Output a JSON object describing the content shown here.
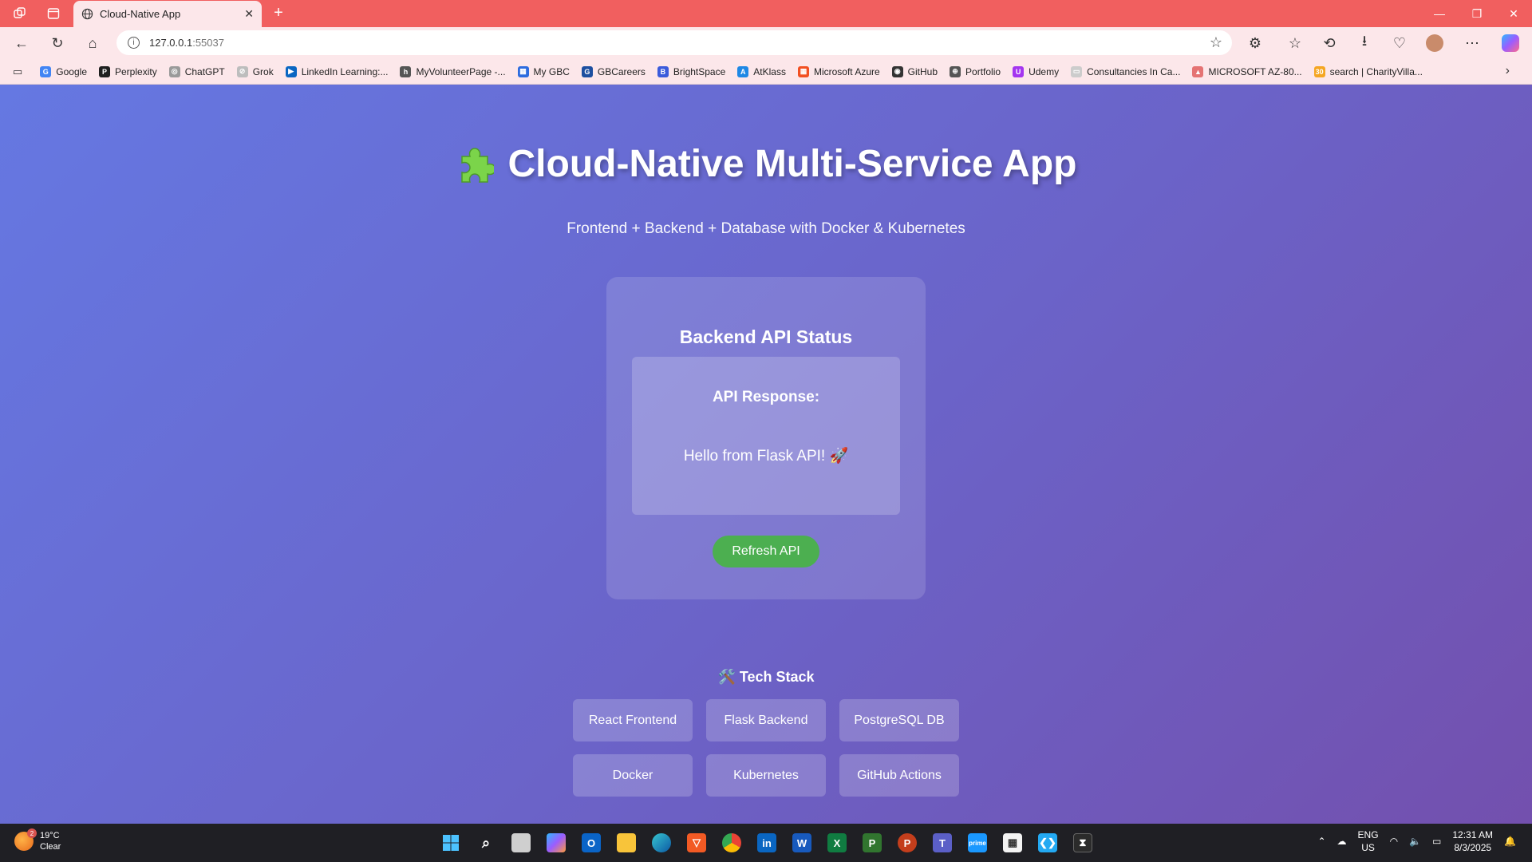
{
  "browser": {
    "tab_title": "Cloud-Native App",
    "url_host": "127.0.0.1",
    "url_port": ":55037",
    "bookmarks": [
      {
        "label": "Google",
        "color": "#4285f4",
        "glyph": "G"
      },
      {
        "label": "Perplexity",
        "color": "#1f1f1f",
        "glyph": "P"
      },
      {
        "label": "ChatGPT",
        "color": "#9a9a9a",
        "glyph": "◎"
      },
      {
        "label": "Grok",
        "color": "#bdbdbd",
        "glyph": "⊘"
      },
      {
        "label": "LinkedIn Learning:...",
        "color": "#0a66c2",
        "glyph": "▶"
      },
      {
        "label": "MyVolunteerPage -...",
        "color": "#555555",
        "glyph": "h"
      },
      {
        "label": "My GBC",
        "color": "#2d6cdf",
        "glyph": "▦"
      },
      {
        "label": "GBCareers",
        "color": "#1d4fa0",
        "glyph": "G"
      },
      {
        "label": "BrightSpace",
        "color": "#3b5bdb",
        "glyph": "B"
      },
      {
        "label": "AtKlass",
        "color": "#1e88e5",
        "glyph": "A"
      },
      {
        "label": "Microsoft Azure",
        "color": "#f25022",
        "glyph": "▦"
      },
      {
        "label": "GitHub",
        "color": "#333333",
        "glyph": "◉"
      },
      {
        "label": "Portfolio",
        "color": "#555555",
        "glyph": "⊕"
      },
      {
        "label": "Udemy",
        "color": "#a435f0",
        "glyph": "U"
      },
      {
        "label": "Consultancies In Ca...",
        "color": "#cccccc",
        "glyph": "▭"
      },
      {
        "label": "MICROSOFT AZ-80...",
        "color": "#e57373",
        "glyph": "▲"
      },
      {
        "label": "search | CharityVilla...",
        "color": "#f5a623",
        "glyph": "30"
      }
    ]
  },
  "page": {
    "title": "Cloud-Native Multi-Service App",
    "subtitle": "Frontend + Backend + Database with Docker & Kubernetes",
    "status_card": {
      "title": "Backend API Status",
      "response_label": "API Response:",
      "response_text": "Hello from Flask API! 🚀",
      "refresh_label": "Refresh API"
    },
    "tech_stack": {
      "title": "🛠️ Tech Stack",
      "items": [
        "React Frontend",
        "Flask Backend",
        "PostgreSQL DB",
        "Docker",
        "Kubernetes",
        "GitHub Actions"
      ]
    }
  },
  "taskbar": {
    "weather_temp": "19°C",
    "weather_desc": "Clear",
    "weather_badge": "2",
    "lang": "ENG",
    "region": "US",
    "time": "12:31 AM",
    "date": "8/3/2025"
  },
  "colors": {
    "tab_bar": "#f15f5f",
    "toolbar": "#fce7ea",
    "page_gradient_start": "#6578e2",
    "page_gradient_end": "#7350ae",
    "refresh_button": "#4caf50"
  }
}
